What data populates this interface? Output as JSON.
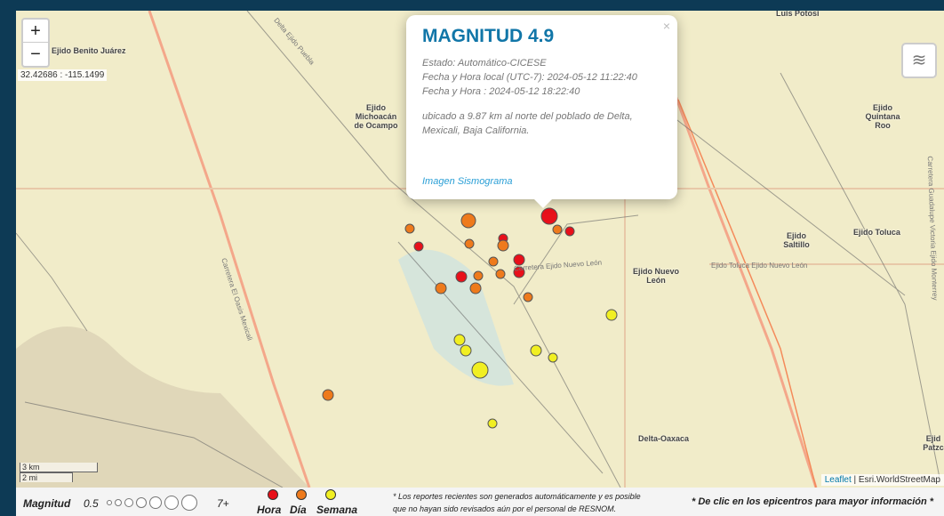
{
  "map": {
    "zoom_in": "+",
    "zoom_out": "−",
    "coordinates": "32.42686 : -115.1499",
    "layers_icon": "layers-icon",
    "places": [
      "Ejido Benito Juárez",
      "Ejido Michoacán de Ocampo",
      "Ejido Quintana Roo",
      "Ejido Toluca",
      "Ejido Saltillo",
      "Ejido Nuevo León",
      "Delta-Oaxaca",
      "Luis Potosí",
      "Ejid Patzc"
    ],
    "roads": [
      "Carretera El Oasis Mexicali",
      "Carretera Guadalupe Victoria Ejido Monterrey",
      "Carretera Ejido Nuevo León",
      "Ejido Toluca Ejido Nuevo León",
      "Delta Ejido Puebla"
    ],
    "scale": {
      "km": "3 km",
      "mi": "2 mi"
    },
    "attribution": {
      "leaflet": "Leaflet",
      "source": "Esri.WorldStreetMap"
    }
  },
  "popup": {
    "title": "MAGNITUD 4.9",
    "estado": "Estado: Automático-CICESE",
    "local": "Fecha y Hora local (UTC-7): 2024-05-12 11:22:40",
    "utc": "Fecha y Hora : 2024-05-12 18:22:40",
    "location": "ubicado a 9.87 km al norte del poblado de Delta, Mexicali, Baja California.",
    "link": "Imagen Sismograma",
    "close": "×"
  },
  "legend": {
    "magnitud": "Magnitud",
    "min": "0.5",
    "max": "7+",
    "hora": "Hora",
    "dia": "Día",
    "semana": "Semana",
    "note1": "* Los reportes recientes son generados automáticamente y es posible",
    "note2": "que no hayan sido revisados aún por el personal de RESNOM.",
    "click": "* De clic en los epicentros para mayor información *"
  },
  "colors": {
    "hora": "#e8101a",
    "dia": "#ee7a1c",
    "semana": "#f1ef22",
    "title": "#1176a8"
  }
}
